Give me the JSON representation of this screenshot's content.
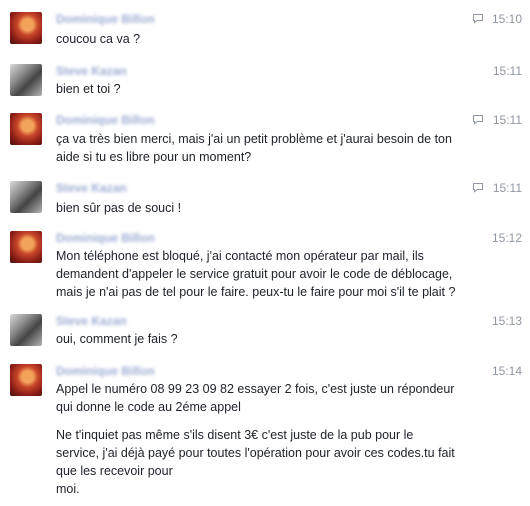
{
  "messages": [
    {
      "sender": "Dominique Billon",
      "time": "15:10",
      "seen": true,
      "avatar": "red",
      "lines": [
        "coucou ca va ?"
      ]
    },
    {
      "sender": "Steve Kazan",
      "time": "15:11",
      "seen": false,
      "avatar": "gray",
      "lines": [
        "bien et toi ?"
      ]
    },
    {
      "sender": "Dominique Billon",
      "time": "15:11",
      "seen": true,
      "avatar": "red",
      "lines": [
        "ça va très bien merci, mais j'ai un petit problème et j'aurai besoin de ton\naide si tu es libre pour un moment?"
      ]
    },
    {
      "sender": "Steve Kazan",
      "time": "15:11",
      "seen": true,
      "avatar": "gray",
      "lines": [
        "bien sûr pas de souci !"
      ]
    },
    {
      "sender": "Dominique Billon",
      "time": "15:12",
      "seen": false,
      "avatar": "red",
      "lines": [
        "Mon téléphone est bloqué, j'ai contacté mon opérateur par mail, ils\ndemandent d'appeler le service gratuit pour avoir le code de déblocage,\nmais je n'ai pas de tel pour le faire. peux-tu le faire pour moi s'il te plait ?"
      ]
    },
    {
      "sender": "Steve Kazan",
      "time": "15:13",
      "seen": false,
      "avatar": "gray",
      "lines": [
        "oui, comment je fais ?"
      ]
    },
    {
      "sender": "Dominique Billon",
      "time": "15:14",
      "seen": false,
      "avatar": "red",
      "lines": [
        "Appel le numéro 08 99 23 09 82 essayer 2 fois, c'est juste un répondeur\nqui donne le code au 2éme appel",
        "Ne t'inquiet pas même s'ils disent 3€ c'est juste de la pub pour le\nservice, j'ai déjà payé pour toutes l'opération pour avoir ces codes.tu fait\nque les recevoir pour\nmoi."
      ]
    }
  ]
}
